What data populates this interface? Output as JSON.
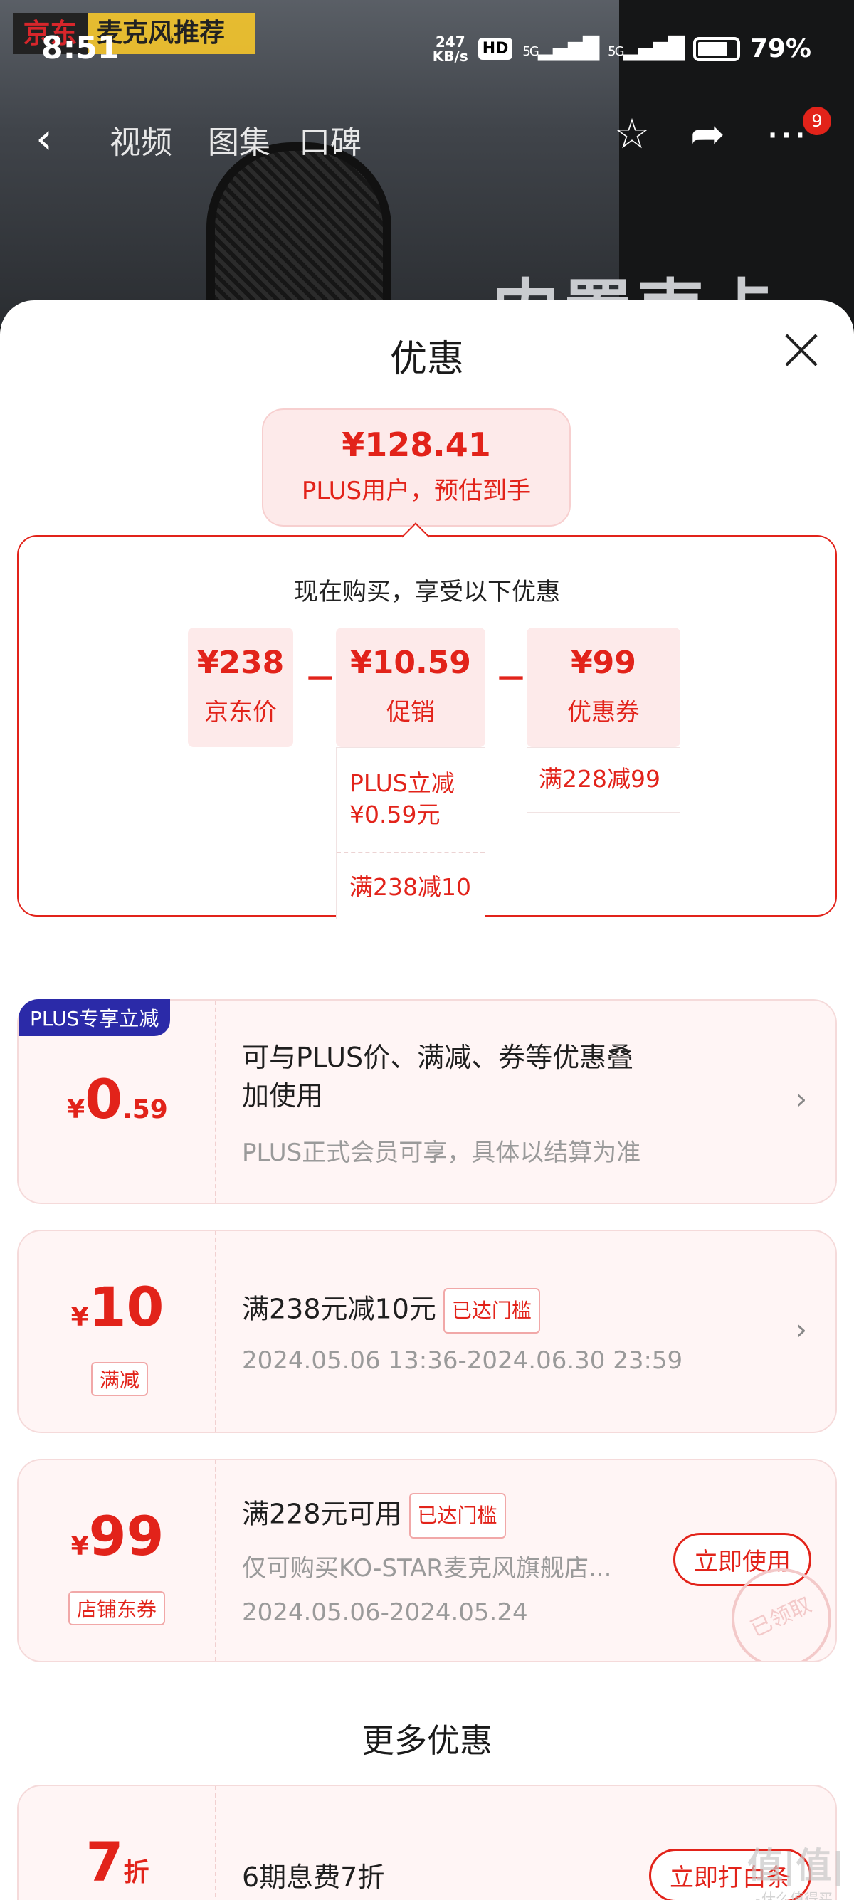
{
  "background": {
    "tag_brand": "京东",
    "tag_text": "麦克风推荐",
    "overlay_text": "内置声卡"
  },
  "status_bar": {
    "time": "8:51",
    "speed_value": "247",
    "speed_unit": "KB/s",
    "hd": "HD",
    "net1": "5G",
    "net2": "5G",
    "battery": "79%"
  },
  "top_nav": {
    "tabs": [
      "视频",
      "图集",
      "口碑"
    ],
    "badge": "9",
    "icons": [
      "back-icon",
      "star-icon",
      "share-icon",
      "more-icon"
    ]
  },
  "sheet": {
    "title": "优惠",
    "estimate": {
      "price": "¥128.41",
      "label": "PLUS用户，预估到手"
    },
    "breakdown": {
      "heading": "现在购买，享受以下优惠",
      "items": [
        {
          "value": "¥238",
          "label": "京东价"
        },
        {
          "value": "¥10.59",
          "label": "促销"
        },
        {
          "value": "¥99",
          "label": "优惠券"
        }
      ],
      "minus": "－",
      "promo_details": [
        "PLUS立减",
        "¥0.59元",
        "满238减10"
      ],
      "coupon_details": [
        "满228减99"
      ]
    },
    "cards": [
      {
        "badge": "PLUS专享立减",
        "currency": "¥",
        "amount_int": "0",
        "amount_dec": ".59",
        "title_line1": "可与PLUS价、满减、券等优惠叠",
        "title_line2": "加使用",
        "subtitle": "PLUS正式会员可享，具体以结算为准"
      },
      {
        "currency": "¥",
        "amount": "10",
        "tag": "满减",
        "title": "满238元减10元",
        "pill": "已达门槛",
        "subtitle": "2024.05.06 13:36-2024.06.30 23:59"
      },
      {
        "currency": "¥",
        "amount": "99",
        "tag": "店铺东券",
        "title": "满228元可用",
        "pill": "已达门槛",
        "subtitle": "仅可购买KO-STAR麦克风旗舰店...",
        "date": "2024.05.06-2024.05.24",
        "button": "立即使用",
        "stamp": "已领取"
      }
    ],
    "more_title": "更多优惠",
    "more_card": {
      "amount": "7",
      "unit": "折",
      "title": "6期息费7折",
      "button": "立即打白条"
    },
    "watermark": "值|值|值",
    "watermark_sub": "什么值得买"
  },
  "colors": {
    "accent": "#e2231a",
    "plus_blue": "#2b2aa8",
    "card_bg": "#fff5f5"
  }
}
